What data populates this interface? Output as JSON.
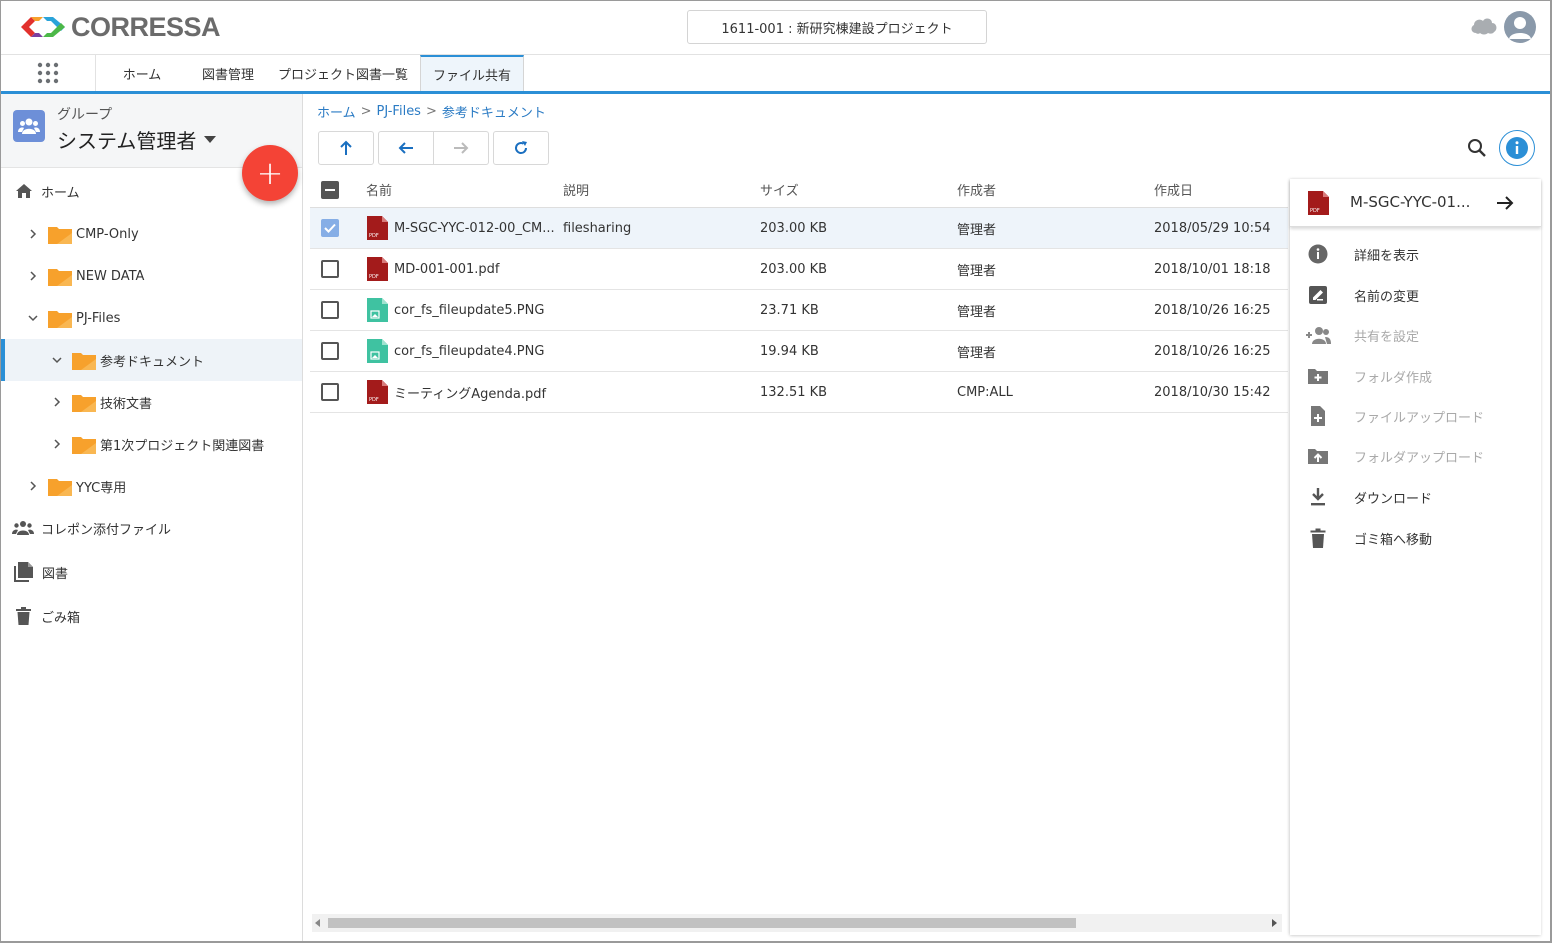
{
  "header": {
    "logo_text": "CORRESSA",
    "project_selector": "1611-001 : 新研究棟建設プロジェクト"
  },
  "nav": {
    "tabs": [
      {
        "label": "ホーム",
        "active": false
      },
      {
        "label": "図書管理",
        "active": false
      },
      {
        "label": "プロジェクト図書一覧",
        "active": false
      },
      {
        "label": "ファイル共有",
        "active": true
      }
    ]
  },
  "sidebar": {
    "group_label": "グループ",
    "group_name": "システム管理者",
    "fab_label": "+",
    "items": [
      {
        "label": "ホーム",
        "icon": "home-icon"
      },
      {
        "label": "CMP-Only",
        "icon": "folder-icon",
        "expanded": false
      },
      {
        "label": "NEW DATA",
        "icon": "folder-icon",
        "expanded": false
      },
      {
        "label": "PJ-Files",
        "icon": "folder-icon",
        "expanded": true
      },
      {
        "label": "参考ドキュメント",
        "icon": "folder-icon",
        "expanded": true,
        "selected": true
      },
      {
        "label": "技術文書",
        "icon": "folder-icon",
        "expanded": false
      },
      {
        "label": "第1次プロジェクト関連図書",
        "icon": "folder-icon",
        "expanded": false
      },
      {
        "label": "YYC専用",
        "icon": "folder-icon",
        "expanded": false
      },
      {
        "label": "コレポン添付ファイル",
        "icon": "group-icon"
      },
      {
        "label": "図書",
        "icon": "documents-icon"
      },
      {
        "label": "ごみ箱",
        "icon": "trash-icon"
      }
    ]
  },
  "breadcrumb": [
    "ホーム",
    "PJ-Files",
    "参考ドキュメント"
  ],
  "breadcrumb_sep": ">",
  "table": {
    "columns": [
      "名前",
      "説明",
      "サイズ",
      "作成者",
      "作成日"
    ],
    "rows": [
      {
        "name": "M-SGC-YYC-012-00_CM...",
        "type": "pdf",
        "desc": "filesharing",
        "size": "203.00 KB",
        "author": "管理者",
        "date": "2018/05/29 10:54",
        "checked": true
      },
      {
        "name": "MD-001-001.pdf",
        "type": "pdf",
        "desc": "",
        "size": "203.00 KB",
        "author": "管理者",
        "date": "2018/10/01 18:18",
        "checked": false
      },
      {
        "name": "cor_fs_fileupdate5.PNG",
        "type": "image",
        "desc": "",
        "size": "23.71 KB",
        "author": "管理者",
        "date": "2018/10/26 16:25",
        "checked": false
      },
      {
        "name": "cor_fs_fileupdate4.PNG",
        "type": "image",
        "desc": "",
        "size": "19.94 KB",
        "author": "管理者",
        "date": "2018/10/26 16:25",
        "checked": false
      },
      {
        "name": "ミーティングAgenda.pdf",
        "type": "pdf",
        "desc": "",
        "size": "132.51 KB",
        "author": "CMP:ALL",
        "date": "2018/10/30 15:42",
        "checked": false
      }
    ]
  },
  "file_icon_text": "PDF",
  "right_panel": {
    "title": "M-SGC-YYC-01...",
    "actions": [
      {
        "label": "詳細を表示",
        "icon": "info-icon",
        "enabled": true
      },
      {
        "label": "名前の変更",
        "icon": "edit-icon",
        "enabled": true
      },
      {
        "label": "共有を設定",
        "icon": "add-user-icon",
        "enabled": false
      },
      {
        "label": "フォルダ作成",
        "icon": "new-folder-icon",
        "enabled": false
      },
      {
        "label": "ファイルアップロード",
        "icon": "file-upload-icon",
        "enabled": false
      },
      {
        "label": "フォルダアップロード",
        "icon": "folder-upload-icon",
        "enabled": false
      },
      {
        "label": "ダウンロード",
        "icon": "download-icon",
        "enabled": true
      },
      {
        "label": "ゴミ箱へ移動",
        "icon": "trash-icon",
        "enabled": true
      }
    ]
  },
  "colors": {
    "accent": "#2b8fd6",
    "fab": "#f44336",
    "folder": "#f7a12c",
    "pdf": "#a31b1b",
    "image": "#3fc2a1"
  }
}
